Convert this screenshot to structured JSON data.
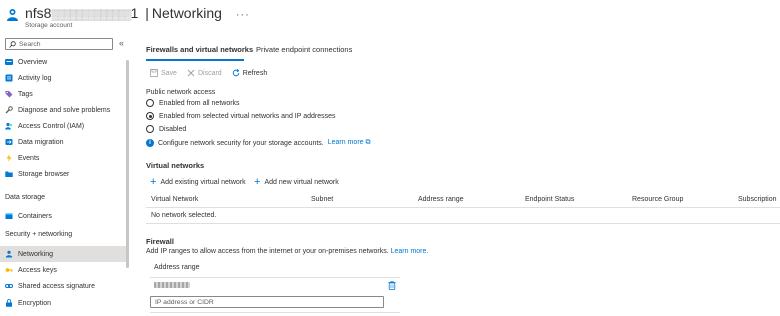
{
  "header": {
    "resource_name_prefix": "nfs8",
    "resource_name_redacted": "▒▒▒▒▒▒▒▒▒▒▒▒▒",
    "resource_name_suffix": "1",
    "separator": "|",
    "page": "Networking",
    "more": "···",
    "subtitle": "Storage account"
  },
  "sidebar": {
    "search_placeholder": "Search",
    "collapse": "«",
    "items": [
      {
        "label": "Overview",
        "icon": "overview-icon",
        "color": "#0078d4"
      },
      {
        "label": "Activity log",
        "icon": "activity-log-icon",
        "color": "#0078d4"
      },
      {
        "label": "Tags",
        "icon": "tag-icon",
        "color": "#8661c5"
      },
      {
        "label": "Diagnose and solve problems",
        "icon": "wrench-icon",
        "color": "#605e5c"
      },
      {
        "label": "Access Control (IAM)",
        "icon": "people-icon",
        "color": "#0078d4"
      },
      {
        "label": "Data migration",
        "icon": "data-migration-icon",
        "color": "#0078d4"
      },
      {
        "label": "Events",
        "icon": "lightning-icon",
        "color": "#ffb900"
      },
      {
        "label": "Storage browser",
        "icon": "folder-icon",
        "color": "#0078d4"
      }
    ],
    "data_storage_section": "Data storage",
    "data_storage_items": [
      {
        "label": "Containers",
        "icon": "container-icon",
        "color": "#0078d4"
      }
    ],
    "security_section": "Security + networking",
    "security_items": [
      {
        "label": "Networking",
        "icon": "networking-icon",
        "color": "#0078d4"
      },
      {
        "label": "Access keys",
        "icon": "key-icon",
        "color": "#ffb900"
      },
      {
        "label": "Shared access signature",
        "icon": "link-icon",
        "color": "#0078d4"
      },
      {
        "label": "Encryption",
        "icon": "lock-icon",
        "color": "#0078d4"
      }
    ]
  },
  "tabs": [
    {
      "label": "Firewalls and virtual networks",
      "active": true
    },
    {
      "label": "Private endpoint connections",
      "active": false
    }
  ],
  "toolbar": {
    "save": "Save",
    "discard": "Discard",
    "refresh": "Refresh"
  },
  "public_access": {
    "label": "Public network access",
    "options": [
      {
        "label": "Enabled from all networks",
        "selected": false
      },
      {
        "label": "Enabled from selected virtual networks and IP addresses",
        "selected": true
      },
      {
        "label": "Disabled",
        "selected": false
      }
    ],
    "info_text": "Configure network security for your storage accounts.",
    "info_link": "Learn more",
    "info_link_icon": "⧉"
  },
  "virtual_networks": {
    "heading": "Virtual networks",
    "add_existing": "Add existing virtual network",
    "add_new": "Add new virtual network",
    "columns": [
      "Virtual Network",
      "Subnet",
      "Address range",
      "Endpoint Status",
      "Resource Group",
      "Subscription"
    ],
    "empty_text": "No network selected."
  },
  "firewall": {
    "heading": "Firewall",
    "description": "Add IP ranges to allow access from the internet or your on-premises networks.",
    "learn_more": "Learn more.",
    "address_range_header": "Address range",
    "input_placeholder": "IP address or CIDR"
  },
  "colors": {
    "accent": "#0078d4",
    "active_nav": "#e1dfdd"
  }
}
